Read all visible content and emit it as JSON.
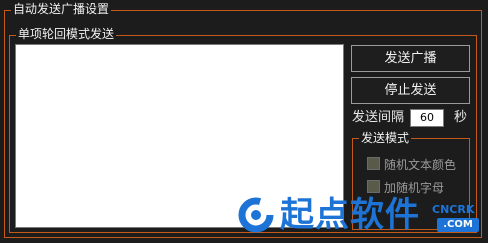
{
  "auto_send": {
    "title": "自动发送广播设置",
    "single_loop": {
      "title": "单项轮回模式发送",
      "textarea_value": ""
    },
    "buttons": {
      "send_broadcast": "发送广播",
      "stop_send": "停止发送"
    },
    "interval": {
      "label": "发送间隔",
      "value": "60",
      "unit": "秒"
    },
    "send_mode": {
      "title": "发送模式",
      "options": [
        {
          "label": "随机文本颜色",
          "checked": false
        },
        {
          "label": "加随机字母",
          "checked": false
        }
      ]
    }
  },
  "watermark": {
    "brand": "起点软件",
    "site_top": "CNCRK",
    "site_bottom": ".COM"
  },
  "colors": {
    "frame_border": "#c45a1a",
    "background": "#1c1c1c",
    "watermark_blue": "#1d74d6"
  }
}
